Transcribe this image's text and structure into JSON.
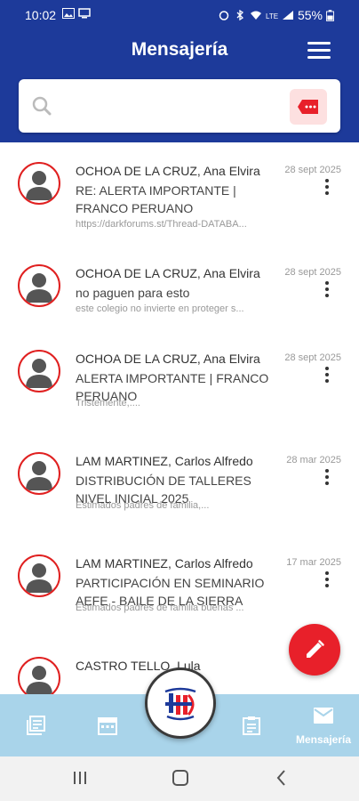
{
  "status_bar": {
    "time": "10:02",
    "battery": "55%",
    "left_icons": [
      "image-icon",
      "screen-icon"
    ],
    "right_icons": [
      "alarm-icon",
      "bluetooth-icon",
      "wifi-icon",
      "lte-icon",
      "signal-icon",
      "battery-icon"
    ]
  },
  "header": {
    "title": "Mensajería",
    "menu_icon": "hamburger-menu-icon"
  },
  "search": {
    "placeholder": "",
    "value": "",
    "icon": "search-icon",
    "tag_button_icon": "tag-icon"
  },
  "messages": [
    {
      "sender": "OCHOA DE LA CRUZ, Ana Elvira",
      "subject": "RE: ALERTA IMPORTANTE | FRANCO PERUANO",
      "preview": "https://darkforums.st/Thread-DATABA...",
      "date": "28 sept 2025"
    },
    {
      "sender": "OCHOA DE LA CRUZ, Ana Elvira",
      "subject": "no paguen para esto",
      "preview": "este colegio no invierte en proteger s...",
      "date": "28 sept 2025"
    },
    {
      "sender": "OCHOA DE LA CRUZ, Ana Elvira",
      "subject": "ALERTA IMPORTANTE | FRANCO PERUANO",
      "preview": "Tristemente,....",
      "date": "28 sept 2025"
    },
    {
      "sender": "LAM MARTINEZ, Carlos Alfredo",
      "subject": "DISTRIBUCIÓN DE TALLERES NIVEL INICIAL 2025",
      "preview": "Estimados padres de familia,...",
      "date": "28 mar 2025"
    },
    {
      "sender": "LAM MARTINEZ, Carlos Alfredo",
      "subject": "PARTICIPACIÓN EN SEMINARIO AEFE - BAILE DE LA SIERRA",
      "preview": "Estimados padres de familia buenas ...",
      "date": "17 mar 2025"
    },
    {
      "sender": "CASTRO TELLO, Lula",
      "subject": "",
      "preview": "",
      "date": ""
    }
  ],
  "fab": {
    "icon": "pencil-icon"
  },
  "bottom_nav": {
    "items": [
      {
        "icon": "news-icon",
        "label": ""
      },
      {
        "icon": "calendar-icon",
        "label": ""
      },
      {
        "icon": "clipboard-icon",
        "label": ""
      },
      {
        "icon": "mail-icon",
        "label": "Mensajería"
      }
    ],
    "center_logo": "school-logo-icon"
  },
  "system_nav": [
    "recent-apps-icon",
    "home-icon",
    "back-icon"
  ],
  "colors": {
    "header": "#1d3a9a",
    "accent": "#e8202a",
    "bottom_nav": "#a9d4ea"
  }
}
